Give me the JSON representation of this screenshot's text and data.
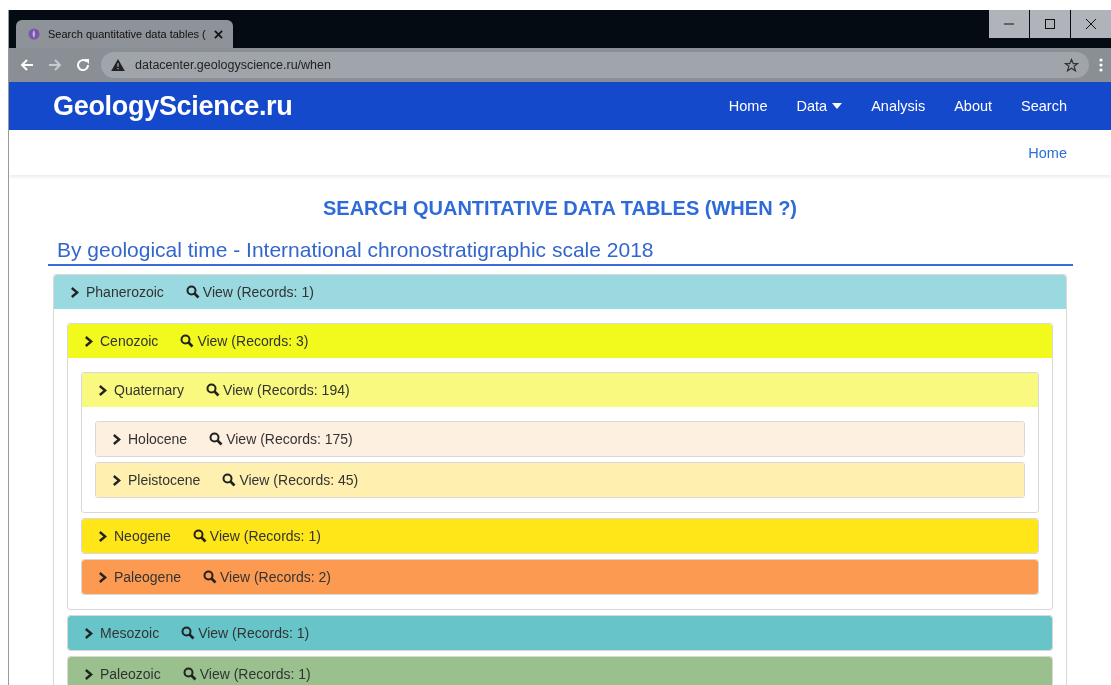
{
  "browser": {
    "tab_title": "Search quantitative data tables (",
    "url": "datacenter.geologyscience.ru/when"
  },
  "navbar": {
    "logo": "GeologyScience.ru",
    "links": [
      {
        "label": "Home",
        "kind": "link"
      },
      {
        "label": "Data",
        "kind": "dropdown"
      },
      {
        "label": "Analysis",
        "kind": "link"
      },
      {
        "label": "About",
        "kind": "link"
      },
      {
        "label": "Search",
        "kind": "link"
      }
    ]
  },
  "breadcrumb": [
    "Home"
  ],
  "title": "SEARCH QUANTITATIVE DATA TABLES (WHEN ?)",
  "subtitle": "By geological time - International chronostratigraphic scale 2018",
  "tree": [
    {
      "name": "Phanerozoic",
      "view": "View (Records: 1)",
      "color": "#9ad9e0",
      "children": [
        {
          "name": "Cenozoic",
          "view": "View (Records: 3)",
          "color": "#f2f91d",
          "children": [
            {
              "name": "Quaternary",
              "view": "View (Records: 194)",
              "color": "#f9f97f",
              "children": [
                {
                  "name": "Holocene",
                  "view": "View (Records: 175)",
                  "color": "#fdf0e1"
                },
                {
                  "name": "Pleistocene",
                  "view": "View (Records: 45)",
                  "color": "#fff0b0"
                }
              ]
            },
            {
              "name": "Neogene",
              "view": "View (Records: 1)",
              "color": "#ffe619"
            },
            {
              "name": "Paleogene",
              "view": "View (Records: 2)",
              "color": "#fd9a52"
            }
          ]
        },
        {
          "name": "Mesozoic",
          "view": "View (Records: 1)",
          "color": "#67c5ca"
        },
        {
          "name": "Paleozoic",
          "view": "View (Records: 1)",
          "color": "#99c08d"
        }
      ]
    }
  ]
}
